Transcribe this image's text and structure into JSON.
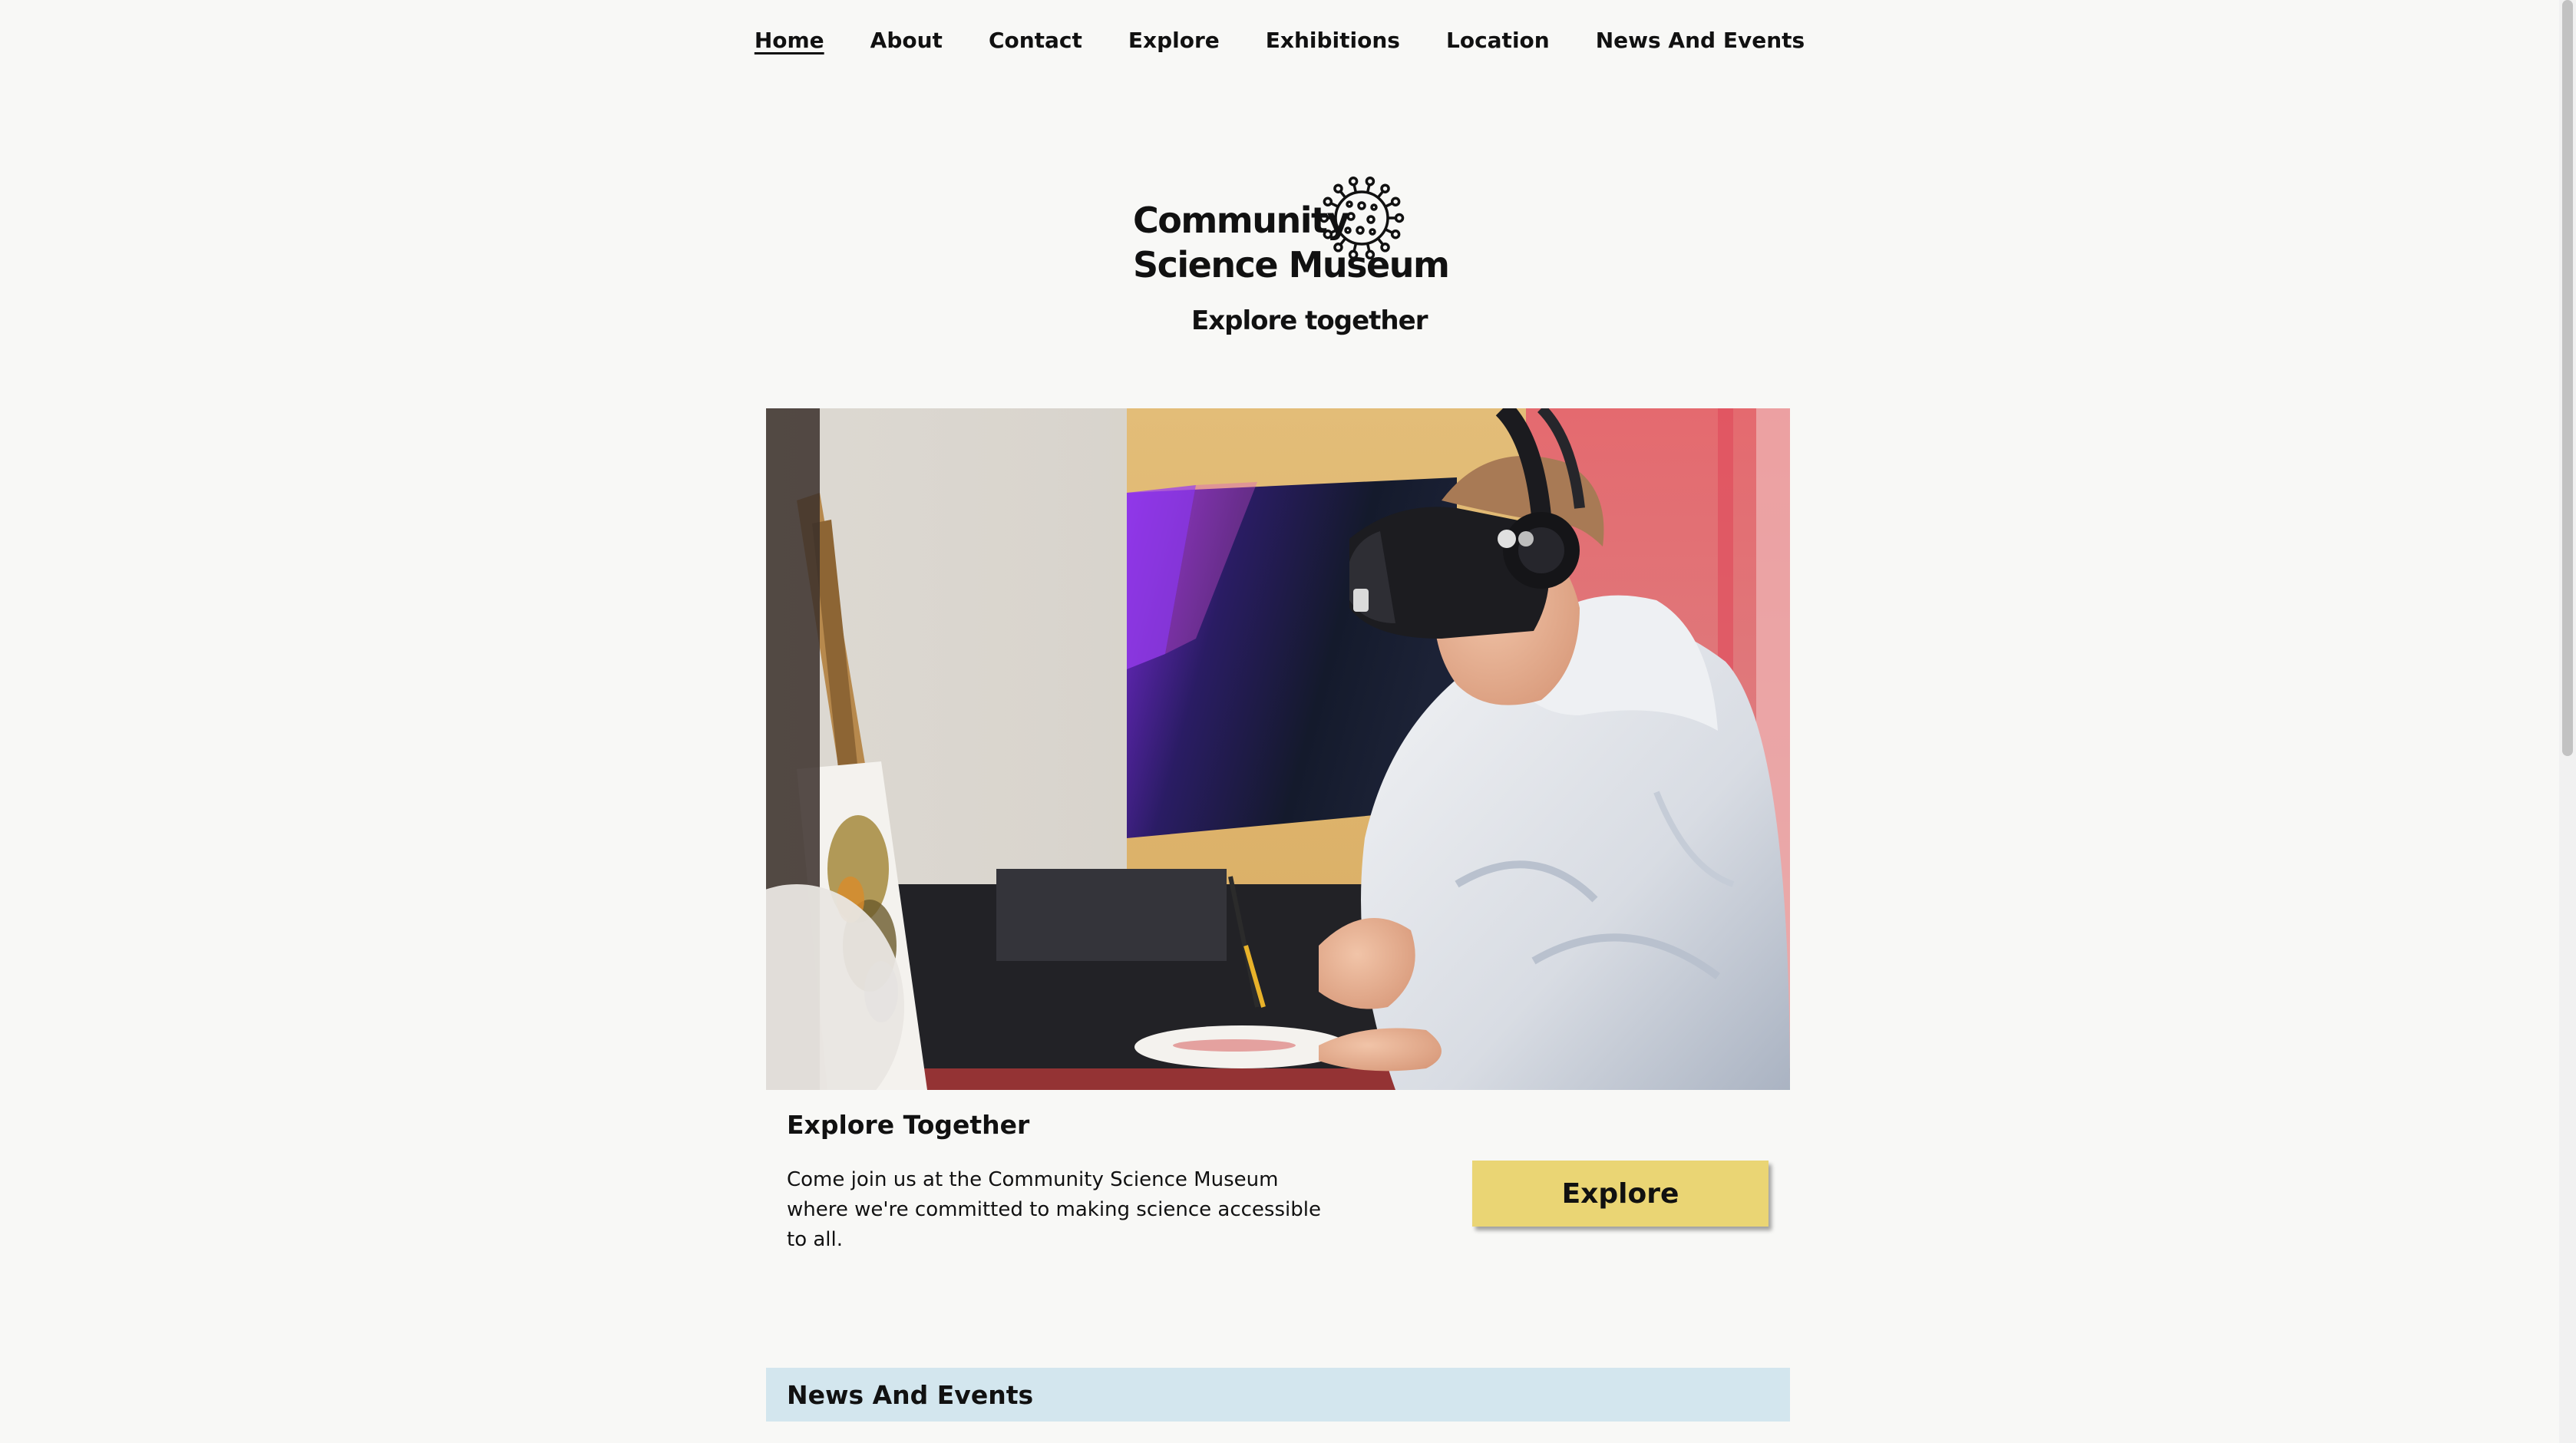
{
  "nav": {
    "items": [
      {
        "label": "Home",
        "active": true
      },
      {
        "label": "About"
      },
      {
        "label": "Contact"
      },
      {
        "label": "Explore"
      },
      {
        "label": "Exhibitions"
      },
      {
        "label": "Location"
      },
      {
        "label": "News And Events"
      }
    ]
  },
  "logo": {
    "line1": "Community",
    "line2": "Science Museum",
    "tagline": "Explore together",
    "icon": "virus-molecule-icon"
  },
  "hero": {
    "image": "vr-headset-painting-photo"
  },
  "explore_section": {
    "title": "Explore Together",
    "body": "Come join us at the Community Science Museum where we're committed to making science accessible to all.",
    "button_label": "Explore"
  },
  "news": {
    "title": "News And Events"
  },
  "colors": {
    "background": "#f8f8f6",
    "button": "#ead574",
    "news_bar": "#d3e6ee",
    "text": "#111111"
  }
}
